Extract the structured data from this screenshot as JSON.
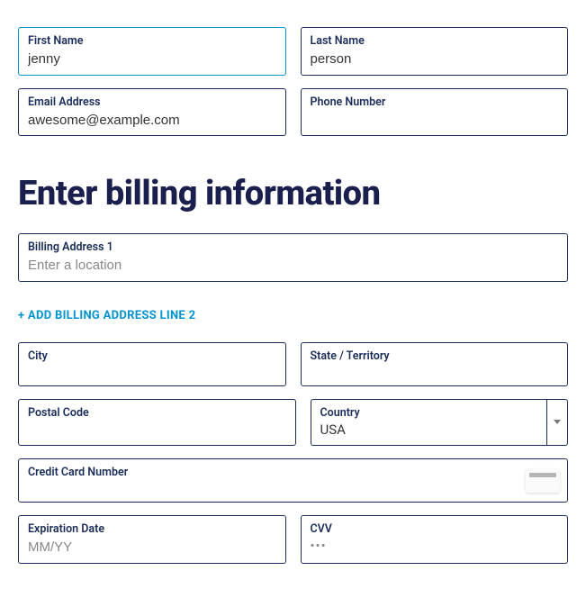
{
  "personal": {
    "first_name_label": "First Name",
    "first_name_value": "jenny",
    "last_name_label": "Last Name",
    "last_name_value": "person",
    "email_label": "Email Address",
    "email_value": "awesome@example.com",
    "phone_label": "Phone Number",
    "phone_value": ""
  },
  "heading": "Enter billing information",
  "billing": {
    "address1_label": "Billing Address 1",
    "address1_value": "",
    "address1_placeholder": "Enter a location",
    "add_line2_label": "+ ADD BILLING ADDRESS LINE 2",
    "city_label": "City",
    "city_value": "",
    "state_label": "State / Territory",
    "state_value": "",
    "postal_label": "Postal Code",
    "postal_value": "",
    "country_label": "Country",
    "country_value": "USA",
    "cc_label": "Credit Card Number",
    "cc_value": "",
    "exp_label": "Expiration Date",
    "exp_value": "",
    "exp_placeholder": "MM/YY",
    "cvv_label": "CVV",
    "cvv_placeholder": "•••",
    "cvv_value": ""
  }
}
